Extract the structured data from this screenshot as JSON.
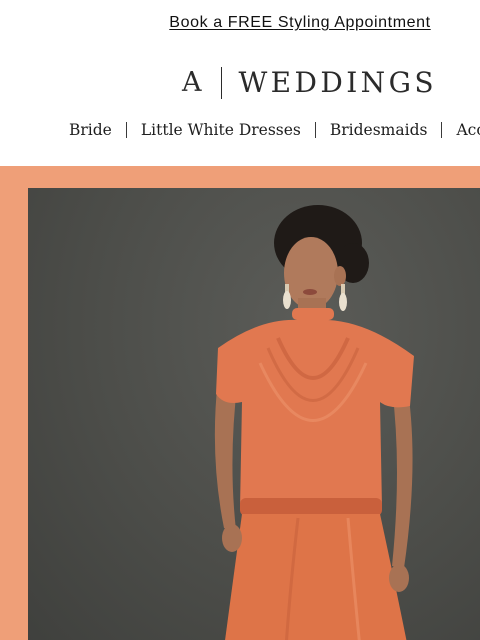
{
  "promo": {
    "label": "Book a FREE Styling Appointment"
  },
  "logo": {
    "mark": "A",
    "text": "WEDDINGS"
  },
  "nav": {
    "items": [
      {
        "label": "Bride"
      },
      {
        "label": "Little White Dresses"
      },
      {
        "label": "Bridesmaids"
      },
      {
        "label": "Acces"
      }
    ]
  },
  "hero": {
    "frame_color": "#ef9f78",
    "backdrop_color": "#4c4d49",
    "dress_color": "#e17850"
  }
}
